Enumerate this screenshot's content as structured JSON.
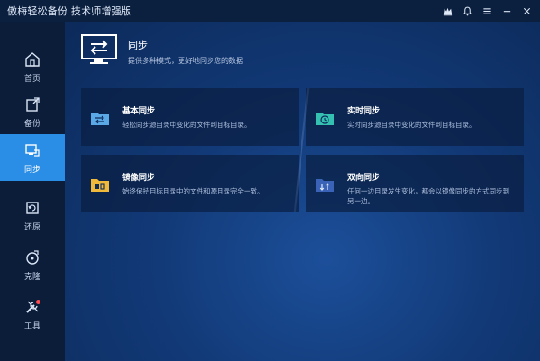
{
  "window": {
    "title": "傲梅轻松备份 技术师增强版",
    "controls": [
      {
        "name": "crown-icon"
      },
      {
        "name": "bell-icon"
      },
      {
        "name": "menu-icon"
      },
      {
        "name": "minimize-icon"
      },
      {
        "name": "close-icon"
      }
    ]
  },
  "sidebar": {
    "items": [
      {
        "label": "首页",
        "icon": "home-icon"
      },
      {
        "label": "备份",
        "icon": "backup-icon"
      },
      {
        "label": "同步",
        "icon": "sync-icon",
        "active": true
      },
      {
        "label": "还原",
        "icon": "restore-icon"
      },
      {
        "label": "克隆",
        "icon": "clone-icon"
      },
      {
        "label": "工具",
        "icon": "tools-icon",
        "badge": true
      }
    ]
  },
  "main": {
    "title": "同步",
    "subtitle": "提供多种模式，更好地同步您的数据",
    "cards": [
      {
        "title": "基本同步",
        "desc": "轻松同步源目录中变化的文件到目标目录。",
        "icon": "basic-sync-folder-icon"
      },
      {
        "title": "实时同步",
        "desc": "实时同步源目录中变化的文件到目标目录。",
        "icon": "realtime-sync-folder-icon"
      },
      {
        "title": "镜像同步",
        "desc": "始终保持目标目录中的文件和源目录完全一致。",
        "icon": "mirror-sync-folder-icon"
      },
      {
        "title": "双向同步",
        "desc": "任何一边目录发生变化，都会以镜像同步的方式同步到另一边。",
        "icon": "two-way-sync-folder-icon"
      }
    ]
  },
  "colors": {
    "accent": "#2b8ee6",
    "sidebar_bg": "#0c1d3a",
    "folder_blue": "#5aa9e6",
    "folder_teal": "#35c1b2",
    "folder_yellow": "#f0b93a",
    "folder_indigo": "#3a63b8",
    "badge": "#ff4d4f"
  }
}
